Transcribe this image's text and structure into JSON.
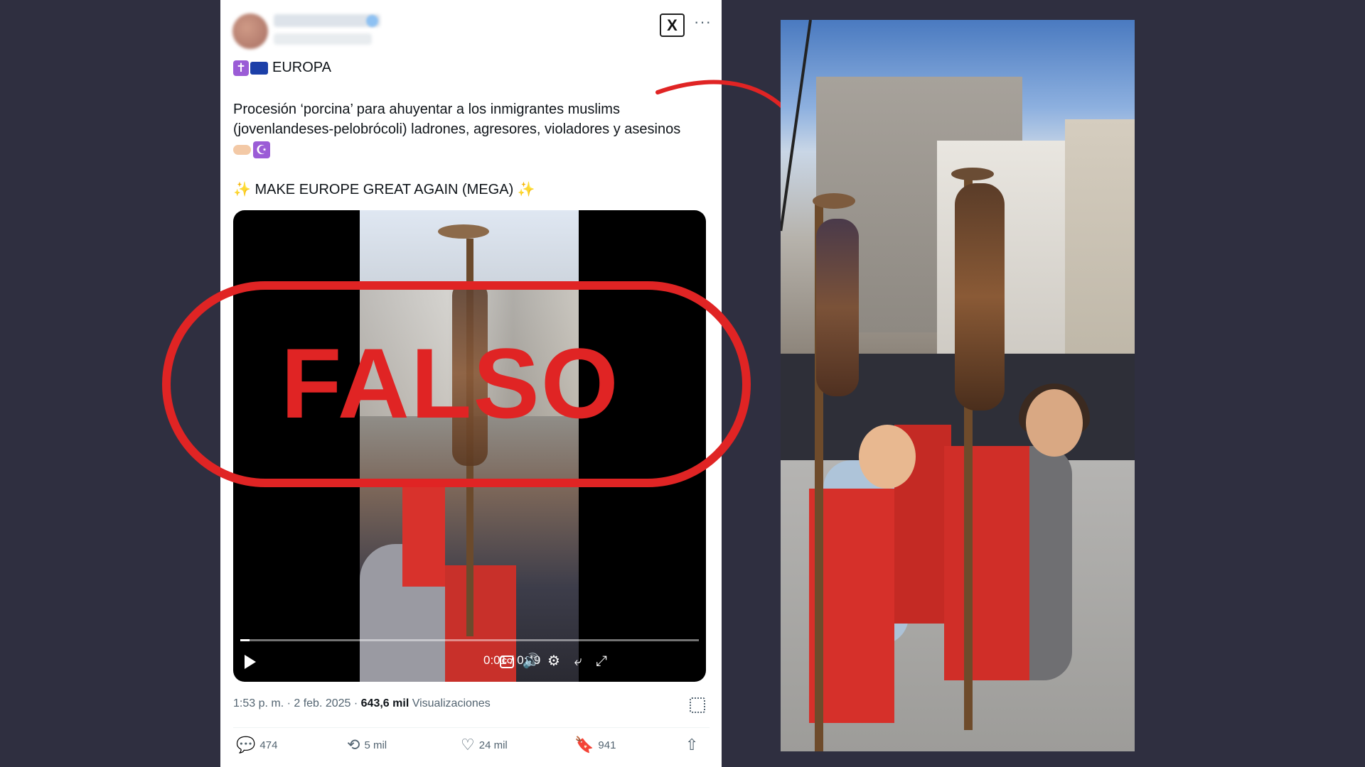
{
  "tweet": {
    "country_label": "EUROPA",
    "body": "Procesión ‘porcina’ para ahuyentar a los inmigrantes muslims (jovenlandeses-pelobrócoli) ladrones, agresores, violadores y asesinos",
    "slogan": "MAKE EUROPE GREAT AGAIN (MEGA)",
    "header_icons": [
      "x-logo-icon",
      "more-options-icon"
    ],
    "meta": {
      "time_date": "1:53 p. m. · 2 feb. 2025 · ",
      "views_count": "643,6 mil",
      "views_label": " Visualizaciones"
    },
    "video": {
      "time": "0:01 / 0:49",
      "progress": 0.02,
      "controls": [
        "play-icon",
        "captions-icon",
        "volume-icon",
        "settings-icon",
        "pop-out-icon",
        "fullscreen-icon"
      ]
    },
    "actions": {
      "replies": "474",
      "reposts": "5 mil",
      "likes": "24 mil",
      "bookmarks": "941"
    }
  },
  "overlay": {
    "stamp_text": "FALSO",
    "stamp_color": "#e02424"
  },
  "colors": {
    "background": "#2f2f40",
    "card": "#ffffff",
    "muted_text": "#536471"
  }
}
